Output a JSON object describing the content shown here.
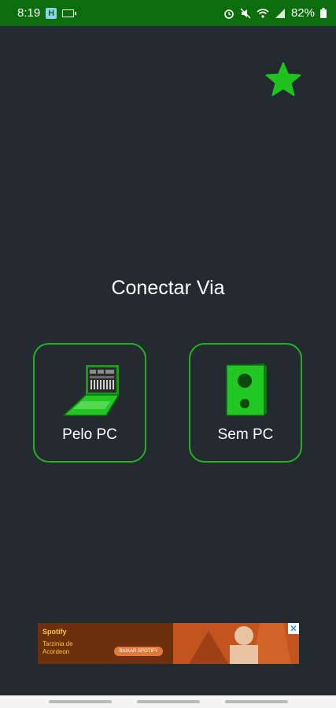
{
  "status_bar": {
    "time": "8:19",
    "app_badge": "H",
    "battery": "82%"
  },
  "heading": "Conectar Via",
  "options": [
    {
      "label": "Pelo PC",
      "icon": "laptop-icon"
    },
    {
      "label": "Sem PC",
      "icon": "speaker-icon"
    }
  ],
  "ad": {
    "brand": "Spotify",
    "line1": "Tarzinia de",
    "line2": "Acordeon",
    "cta": "BAIXAR SPOTIFY",
    "close": "✕"
  },
  "colors": {
    "accent": "#22b222",
    "status_bar": "#0b6d0b",
    "background": "#232a30",
    "star": "#1fc21f"
  }
}
